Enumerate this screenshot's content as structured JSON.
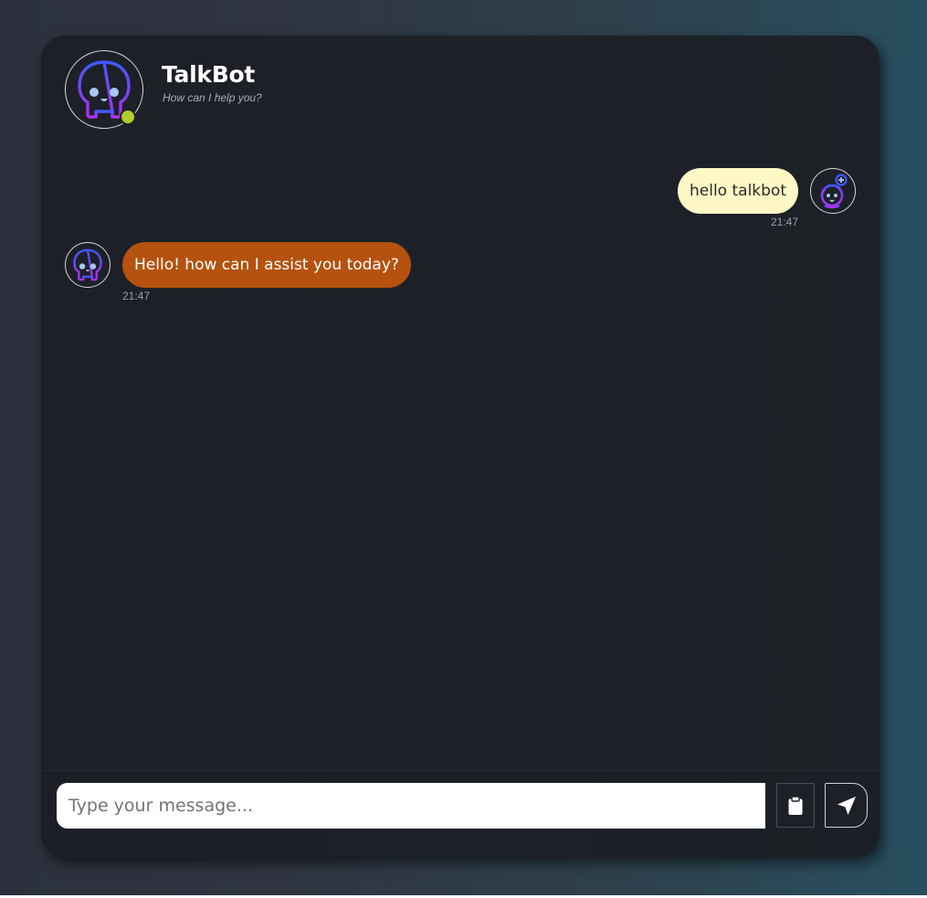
{
  "header": {
    "bot_name": "TalkBot",
    "subtitle": "How can I help you?",
    "status": "online",
    "status_color": "#b4cc2c"
  },
  "messages": [
    {
      "sender": "user",
      "text": "hello talkbot",
      "time": "21:47",
      "bubble_color": "#fef8c6"
    },
    {
      "sender": "bot",
      "text": "Hello! how can I assist you today?",
      "time": "21:47",
      "bubble_color": "#b5520f"
    }
  ],
  "composer": {
    "placeholder": "Type your message...",
    "value": "",
    "attach_icon": "clipboard-icon",
    "send_icon": "paper-plane-icon"
  },
  "icons": {
    "bot_avatar": "skull-bot-icon",
    "user_avatar": "user-avatar-icon"
  }
}
